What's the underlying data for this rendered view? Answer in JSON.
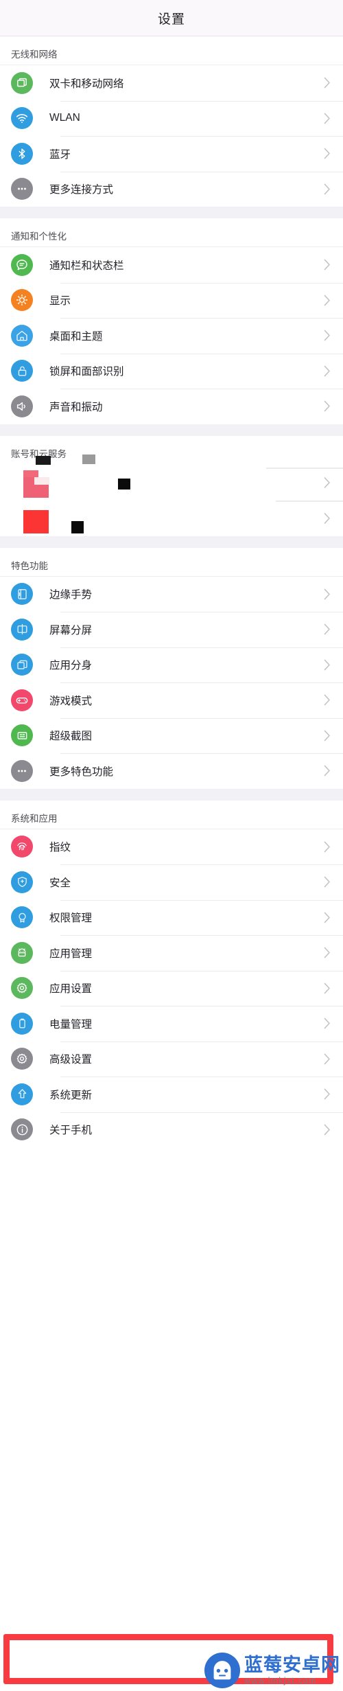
{
  "window": {
    "title": "设置"
  },
  "sections": [
    {
      "id": "wireless-and-network",
      "header": "无线和网络",
      "items": [
        {
          "label": "双卡和移动网络",
          "icon": "sim-card-icon",
          "icon_bg": "#5cb85c",
          "chevron": "chevron-right-icon"
        },
        {
          "label": "WLAN",
          "icon": "wifi-icon",
          "icon_bg": "#2f9de0",
          "chevron": "chevron-right-icon"
        },
        {
          "label": "蓝牙",
          "icon": "bluetooth-icon",
          "icon_bg": "#2f9de0",
          "chevron": "chevron-right-icon"
        },
        {
          "label": "更多连接方式",
          "icon": "more-dots-icon",
          "icon_bg": "#8a8a90",
          "chevron": "chevron-right-icon"
        }
      ]
    },
    {
      "id": "notification-and-personalization",
      "header": "通知和个性化",
      "items": [
        {
          "label": "通知栏和状态栏",
          "icon": "chat-bubble-icon",
          "icon_bg": "#4fb94f",
          "chevron": "chevron-right-icon"
        },
        {
          "label": "显示",
          "icon": "brightness-sun-icon",
          "icon_bg": "#f58220",
          "chevron": "chevron-right-icon"
        },
        {
          "label": "桌面和主题",
          "icon": "home-icon",
          "icon_bg": "#3ba2e5",
          "chevron": "chevron-right-icon"
        },
        {
          "label": "锁屏和面部识别",
          "icon": "lock-open-icon",
          "icon_bg": "#2f9de0",
          "chevron": "chevron-right-icon"
        },
        {
          "label": "声音和振动",
          "icon": "speaker-volume-icon",
          "icon_bg": "#8a8a90",
          "chevron": "chevron-right-icon"
        }
      ]
    },
    {
      "id": "account-and-cloud",
      "header": "账号和云服务",
      "redacted": true,
      "items": [
        {
          "label": "",
          "icon": "redacted-icon",
          "chevron": "chevron-right-icon"
        },
        {
          "label": "",
          "icon": "redacted-icon",
          "chevron": "chevron-right-icon"
        }
      ]
    },
    {
      "id": "featured-functions",
      "header": "特色功能",
      "items": [
        {
          "label": "边缘手势",
          "icon": "edge-gesture-icon",
          "icon_bg": "#2f9de0",
          "chevron": "chevron-right-icon"
        },
        {
          "label": "屏幕分屏",
          "icon": "split-screen-icon",
          "icon_bg": "#2f9de0",
          "chevron": "chevron-right-icon"
        },
        {
          "label": "应用分身",
          "icon": "app-clone-icon",
          "icon_bg": "#2f9de0",
          "chevron": "chevron-right-icon"
        },
        {
          "label": "游戏模式",
          "icon": "gamepad-icon",
          "icon_bg": "#f2486b",
          "chevron": "chevron-right-icon"
        },
        {
          "label": "超级截图",
          "icon": "screenshot-icon",
          "icon_bg": "#4fb94f",
          "chevron": "chevron-right-icon"
        },
        {
          "label": "更多特色功能",
          "icon": "more-dots-icon",
          "icon_bg": "#8a8a90",
          "chevron": "chevron-right-icon"
        }
      ]
    },
    {
      "id": "system-and-apps",
      "header": "系统和应用",
      "items": [
        {
          "label": "指纹",
          "icon": "fingerprint-icon",
          "icon_bg": "#f2486b",
          "chevron": "chevron-right-icon"
        },
        {
          "label": "安全",
          "icon": "shield-plus-icon",
          "icon_bg": "#2f9de0",
          "chevron": "chevron-right-icon"
        },
        {
          "label": "权限管理",
          "icon": "badge-ribbon-icon",
          "icon_bg": "#2f9de0",
          "chevron": "chevron-right-icon"
        },
        {
          "label": "应用管理",
          "icon": "android-robot-icon",
          "icon_bg": "#5cb85c",
          "chevron": "chevron-right-icon"
        },
        {
          "label": "应用设置",
          "icon": "gear-icon",
          "icon_bg": "#5cb85c",
          "chevron": "chevron-right-icon"
        },
        {
          "label": "电量管理",
          "icon": "battery-icon",
          "icon_bg": "#2f9de0",
          "chevron": "chevron-right-icon"
        },
        {
          "label": "高级设置",
          "icon": "gear-icon",
          "icon_bg": "#8a8a90",
          "chevron": "chevron-right-icon"
        },
        {
          "label": "系统更新",
          "icon": "upload-arrow-icon",
          "icon_bg": "#2f9de0",
          "chevron": "chevron-right-icon"
        },
        {
          "label": "关于手机",
          "icon": "info-circle-icon",
          "icon_bg": "#8a8a90",
          "chevron": "chevron-right-icon",
          "highlighted": true
        }
      ]
    }
  ],
  "annotation": {
    "highlight_color": "#f83b40",
    "target_label": "关于手机"
  },
  "watermark": {
    "site_name": "蓝莓安卓网",
    "url": "www.lmkjst.com",
    "mascot": "android-mascot-icon",
    "brand_color": "#2f6fd0"
  }
}
